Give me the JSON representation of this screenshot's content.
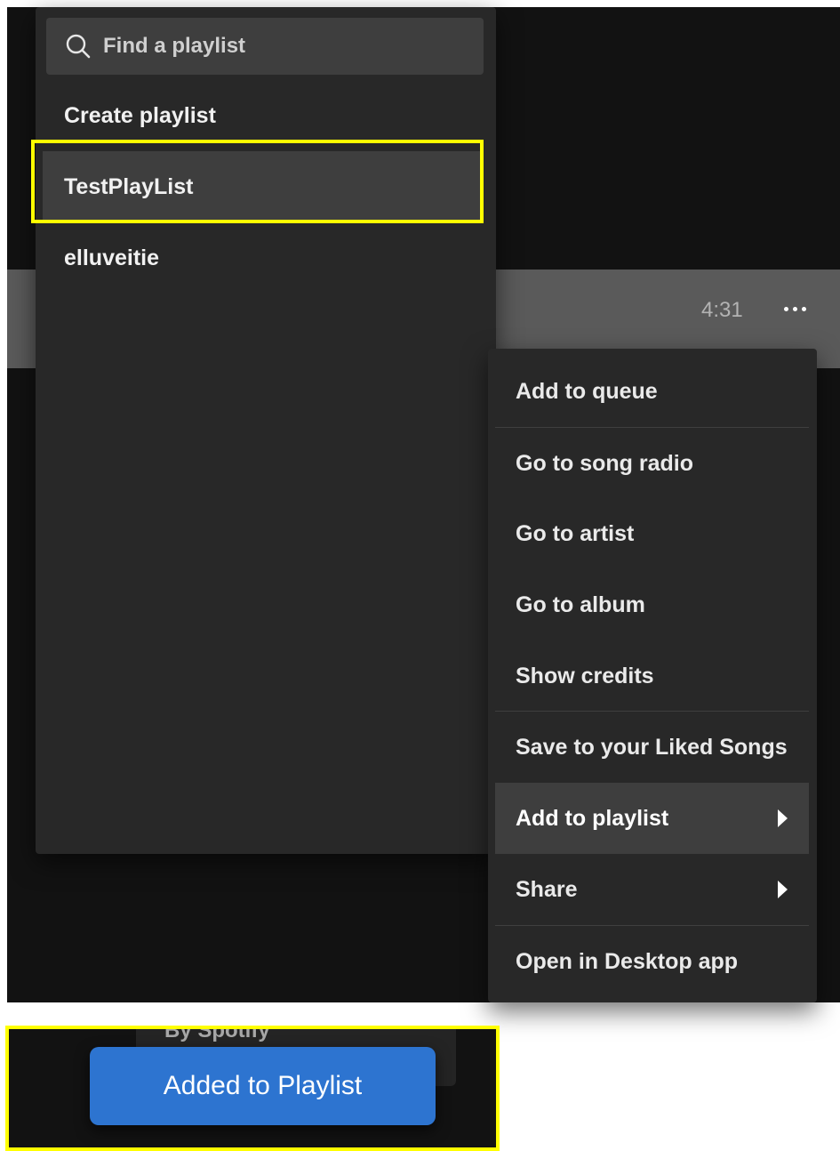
{
  "playlist_menu": {
    "search_placeholder": "Find a playlist",
    "items": [
      {
        "label": "Create playlist"
      },
      {
        "label": "TestPlayList"
      },
      {
        "label": "elluveitie"
      }
    ]
  },
  "track": {
    "duration": "4:31"
  },
  "context_menu": {
    "items": [
      {
        "label": "Add to queue"
      },
      {
        "label": "Go to song radio"
      },
      {
        "label": "Go to artist"
      },
      {
        "label": "Go to album"
      },
      {
        "label": "Show credits"
      },
      {
        "label": "Save to your Liked Songs"
      },
      {
        "label": "Add to playlist"
      },
      {
        "label": "Share"
      },
      {
        "label": "Open in Desktop app"
      }
    ]
  },
  "background_card": {
    "text": "By Spotify"
  },
  "toast": {
    "message": "Added to Playlist"
  },
  "colors": {
    "highlight": "#ffff00",
    "toast_bg": "#2d74d0",
    "menu_bg": "#282828",
    "app_bg": "#121212"
  }
}
